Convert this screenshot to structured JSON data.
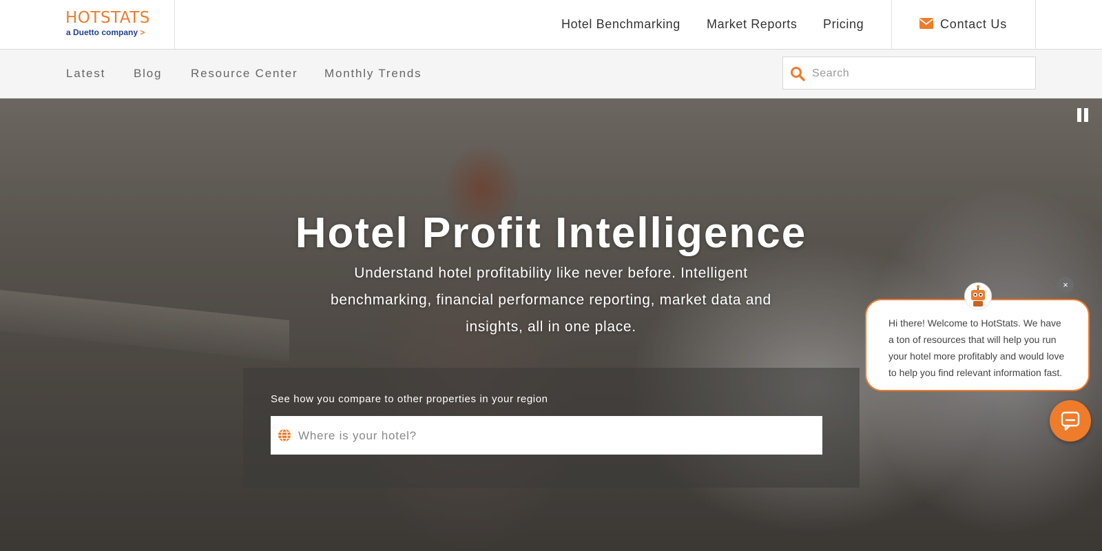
{
  "header": {
    "logo": {
      "brand": "HOTSTATS",
      "tagline": "a Duetto company",
      "tagline_chevron": ">"
    },
    "nav": [
      {
        "label": "Hotel Benchmarking"
      },
      {
        "label": "Market Reports"
      },
      {
        "label": "Pricing"
      }
    ],
    "contact": {
      "label": "Contact Us",
      "icon": "envelope-icon"
    }
  },
  "subnav": {
    "items": [
      {
        "label": "Latest"
      },
      {
        "label": "Blog"
      },
      {
        "label": "Resource Center"
      },
      {
        "label": "Monthly Trends"
      }
    ],
    "search": {
      "placeholder": "Search",
      "icon": "search-icon"
    }
  },
  "hero": {
    "title": "Hotel Profit Intelligence",
    "subtitle": "Understand hotel profitability like never before. Intelligent benchmarking, financial performance reporting, market data and insights, all in one place.",
    "pause_icon": "pause-icon",
    "compare": {
      "label": "See how you compare to other properties in your region",
      "input_placeholder": "Where is your hotel?",
      "icon": "globe-icon"
    }
  },
  "chat": {
    "close_label": "×",
    "message": "Hi there! Welcome to HotStats. We have a ton of resources that will help you run your hotel more profitably and would love to help you find relevant information fast.",
    "avatar_icon": "robot-avatar-icon",
    "launcher_icon": "chat-icon"
  },
  "colors": {
    "accent": "#ef7c2b",
    "brand_navy": "#24408e",
    "nav_text": "#333333",
    "subnav_text": "#666666",
    "subnav_bg": "#f5f5f5"
  }
}
